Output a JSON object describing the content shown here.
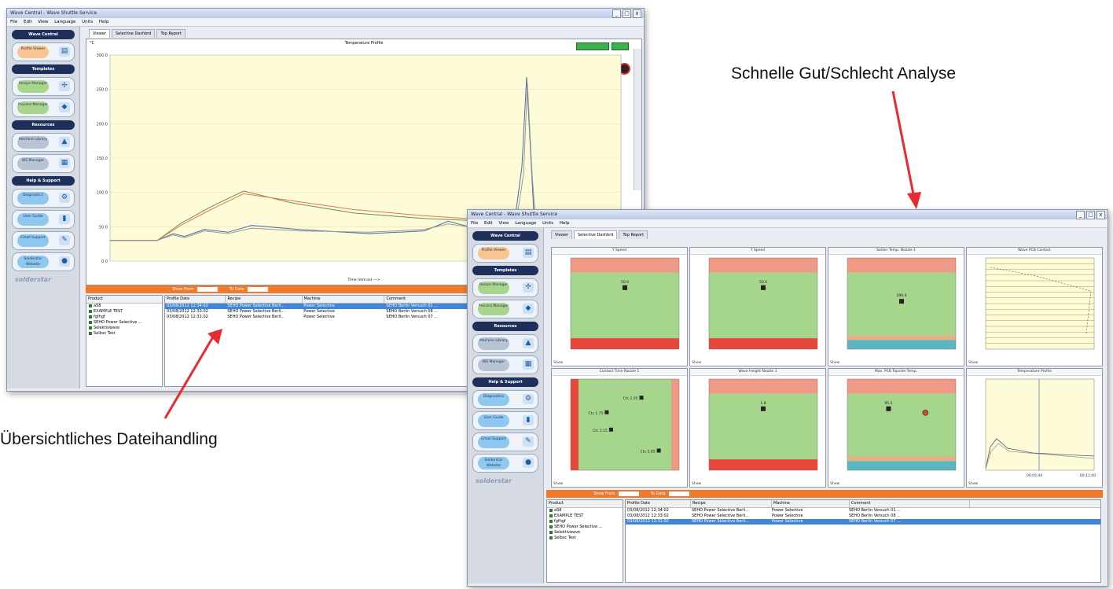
{
  "annotations": {
    "top_right": "Schnelle Gut/Schlecht Analyse",
    "bottom_left": "Übersichtliches Dateihandling",
    "arrow_color": "#e8292f"
  },
  "window": {
    "title": "Wave Central - Wave Shuttle Service",
    "menu": [
      "File",
      "Edit",
      "View",
      "Language",
      "Units",
      "Help"
    ],
    "controls": [
      "_",
      "□",
      "x"
    ]
  },
  "sidebar": {
    "header": "Wave Central",
    "sections": [
      {
        "label": "Templates"
      },
      {
        "label": "Resources"
      },
      {
        "label": "Help & Support"
      }
    ],
    "buttons": [
      {
        "label": "Profile Viewer",
        "icon": "chart-icon",
        "color": "#f7c58f"
      },
      {
        "label": "Recipe Manager",
        "icon": "tree-icon",
        "color": "#a9d48c"
      },
      {
        "label": "Process Manager",
        "icon": "cube-icon",
        "color": "#a9d48c"
      },
      {
        "label": "Machine Library",
        "icon": "mountain-icon",
        "color": "#b8c3d4"
      },
      {
        "label": "WS Manager",
        "icon": "grid-icon",
        "color": "#b8c3d4"
      },
      {
        "label": "Diagnostics",
        "icon": "gear-icon",
        "color": "#8fc8ef"
      },
      {
        "label": "User Guide",
        "icon": "book-icon",
        "color": "#8fc8ef"
      },
      {
        "label": "Email Support",
        "icon": "pencil-icon",
        "color": "#8fc8ef"
      },
      {
        "label": "Solderstar Website",
        "icon": "globe-icon",
        "color": "#8fc8ef"
      }
    ],
    "logo": "solderstar"
  },
  "tabs": [
    "Viewer",
    "Selective Dashbrd",
    "Top Report"
  ],
  "profile_chart": {
    "title": "Temperature Profile",
    "xlabel": "Time (mm:ss) --->",
    "ylabel": "°C",
    "ylim": [
      0,
      300
    ],
    "yticks": [
      "300.0",
      "250.0",
      "200.0",
      "150.0",
      "100.0",
      "50.0",
      "0.0"
    ],
    "series_colors": [
      "#6b8e4e",
      "#e07a4a",
      "#4a6aa0",
      "#9a9a9a"
    ]
  },
  "filter_bar": {
    "from_label": "Show From",
    "to_label": "To Date"
  },
  "products": {
    "header": "Product",
    "items": [
      "a58",
      "EXAMPLE TEST",
      "fgfhgf",
      "SEHO Power Selective ...",
      "Selektivwave",
      "Selbsc Test"
    ]
  },
  "profiles_table": {
    "columns": [
      "Profile Date",
      "Recipe",
      "Machine",
      "Comment"
    ],
    "rows": [
      [
        "03/08/2012 12:34:02",
        "SEHO Power Selective Berli...",
        "Power Selective",
        "SEHO Berlin Versuch 01 ..."
      ],
      [
        "03/08/2012 12:33:02",
        "SEHO Power Selective Berli...",
        "Power Selective",
        "SEHO Berlin Versuch 08 ..."
      ],
      [
        "03/08/2012 12:31:02",
        "SEHO Power Selective Berli...",
        "Power Selective",
        "SEHO Berlin Versuch 07 ..."
      ]
    ],
    "selected_top": 0,
    "selected_front": 2
  },
  "dashboard_panels": [
    {
      "title": "Y Speed",
      "value": "50.0",
      "show": "Show"
    },
    {
      "title": "Y Speed",
      "value": "50.0",
      "show": "Show"
    },
    {
      "title": "Solder Temp. Nozzle 1",
      "value": "296.6",
      "show": "Show"
    },
    {
      "title": "Wave PCB Contact",
      "value": "",
      "show": "Show"
    },
    {
      "title": "Contact Time Nozzle 1",
      "value": "",
      "show": "Show"
    },
    {
      "title": "Wave Height Nozzle 1",
      "value": "1.8",
      "show": "Show"
    },
    {
      "title": "Max. PCB Topside Temp.",
      "value": "95.5",
      "show": "Show"
    },
    {
      "title": "Temperature Profile",
      "value": "",
      "show": "Show"
    }
  ],
  "contact_labels": [
    "Ctc 2.05",
    "Ctc 1.75",
    "Ctc 2.15",
    "Ctc 2.85"
  ],
  "profile_mini_x": [
    "00:05:00",
    "00:11:00"
  ],
  "zones": {
    "high": "#ef9a86",
    "ok": "#a6d58c",
    "low": "#5ab7c2",
    "bad": "#e5483a"
  }
}
